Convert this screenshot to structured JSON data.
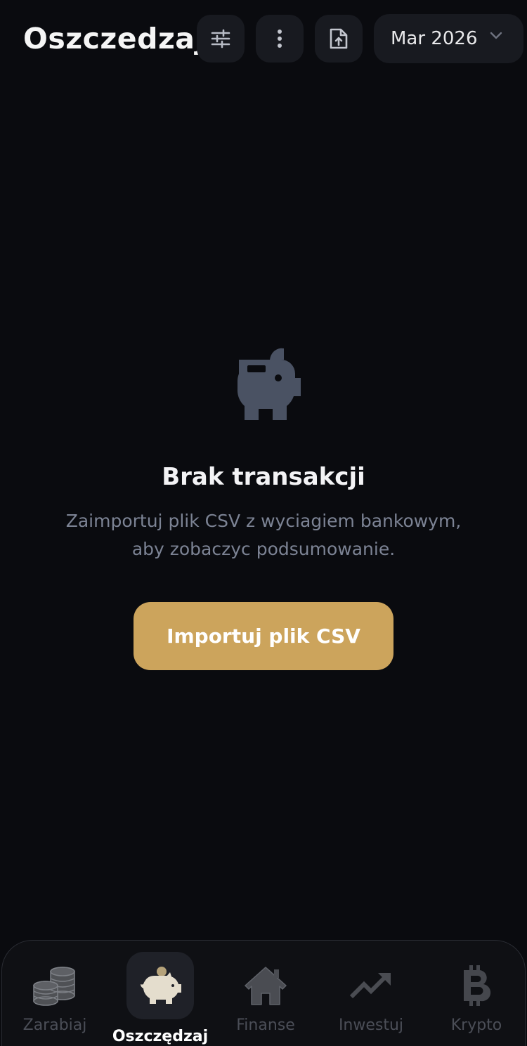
{
  "header": {
    "title": "Oszczedzaj",
    "filter_icon": "sliders-icon",
    "more_icon": "more-vertical-icon",
    "upload_icon": "file-upload-icon",
    "month_select": {
      "value": "Mar 2026",
      "icon": "chevron-down-icon"
    }
  },
  "empty_state": {
    "icon": "piggy-bank-icon",
    "title": "Brak transakcji",
    "description": "Zaimportuj plik CSV z wyciagiem bankowym, aby zobaczyc podsumowanie.",
    "button_label": "Importuj plik CSV"
  },
  "bottom_nav": {
    "items": [
      {
        "label": "Zarabiaj",
        "icon": "coins-stack-icon",
        "active": false
      },
      {
        "label": "Oszczędzaj",
        "icon": "piggy-bank-icon",
        "active": true
      },
      {
        "label": "Finanse",
        "icon": "home-icon",
        "active": false
      },
      {
        "label": "Inwestuj",
        "icon": "trending-up-icon",
        "active": false
      },
      {
        "label": "Krypto",
        "icon": "bitcoin-icon",
        "active": false
      }
    ]
  },
  "colors": {
    "background": "#0a0b0f",
    "surface": "#181a20",
    "accent": "#cca45c",
    "muted_text": "#7c8394",
    "icon_muted": "#4a5263"
  }
}
